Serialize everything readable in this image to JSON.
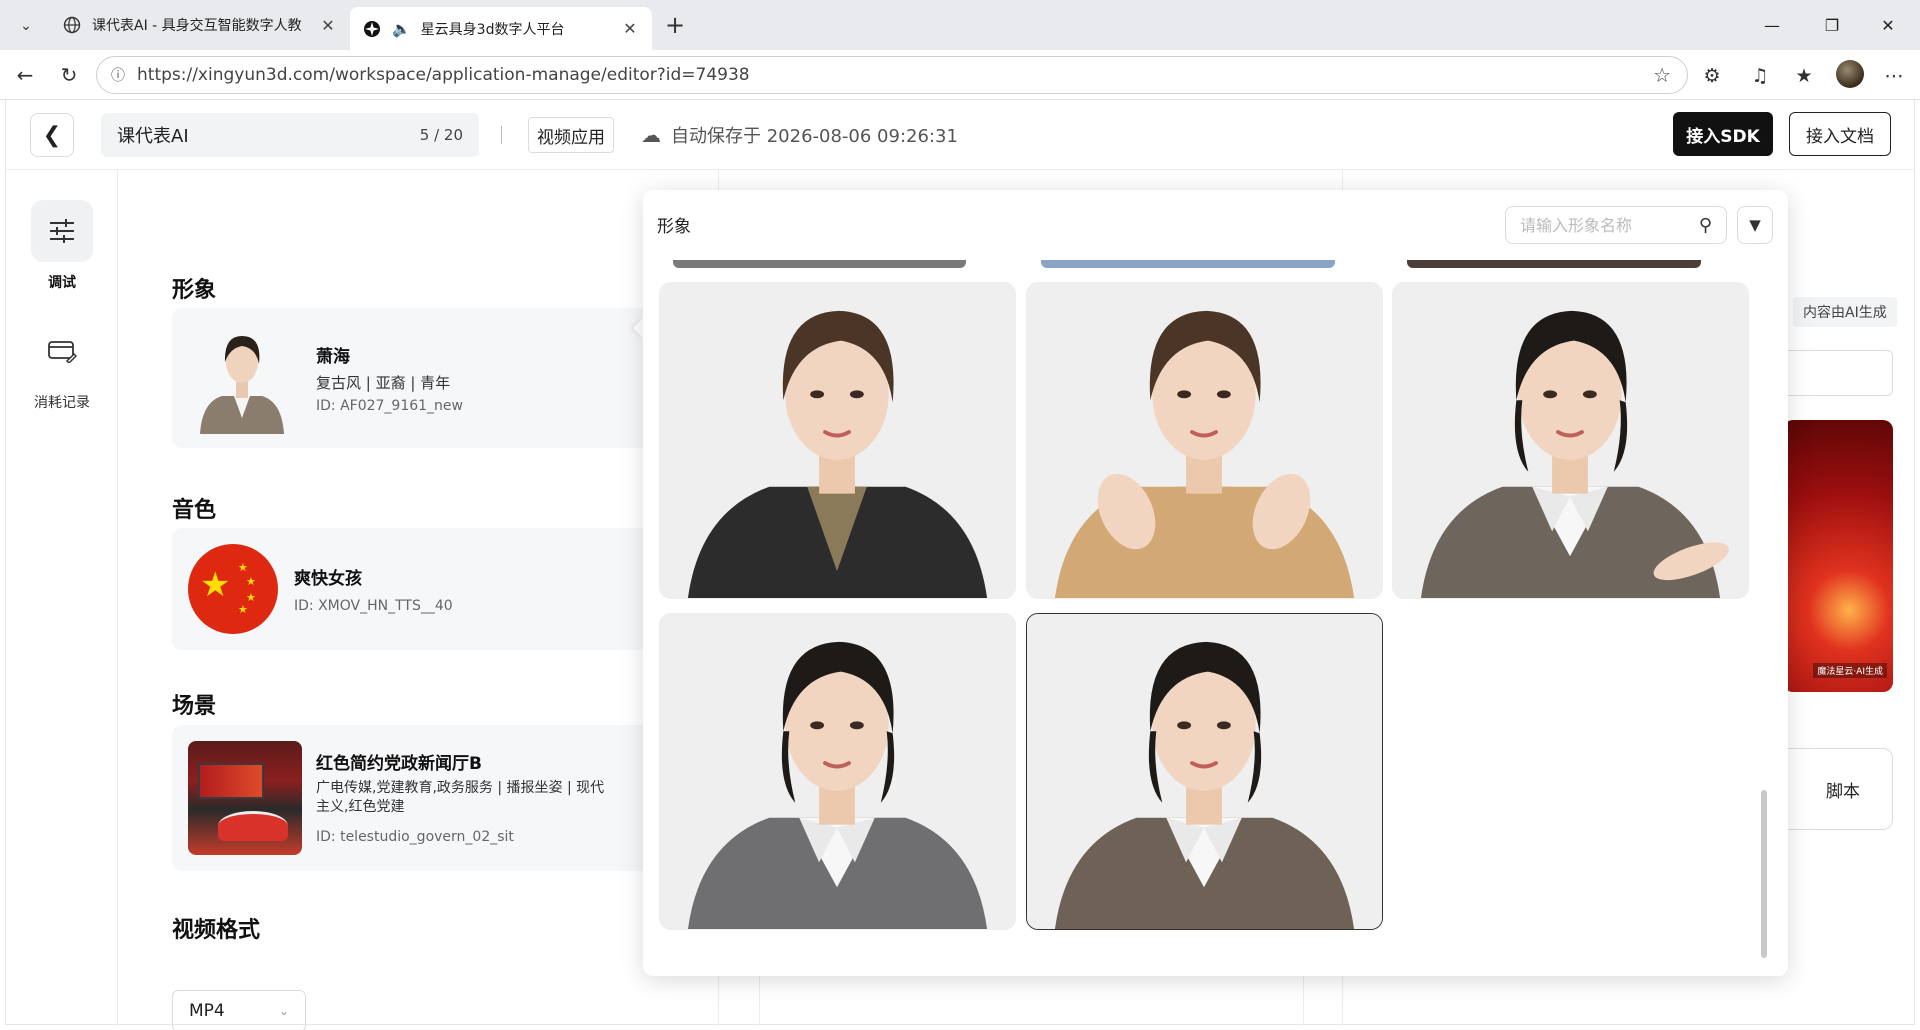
{
  "browser": {
    "tabs": [
      {
        "title": "课代表AI - 具身交互智能数字人教",
        "active": false
      },
      {
        "title": "星云具身3d数字人平台",
        "active": true
      }
    ],
    "url": "https://xingyun3d.com/workspace/application-manage/editor?id=74938"
  },
  "header": {
    "title": "课代表AI",
    "title_count": "5 / 20",
    "app_type": "视频应用",
    "autosave": "自动保存于 2026-08-06 09:26:31",
    "sdk_button": "接入SDK",
    "doc_button": "接入文档"
  },
  "leftnav": [
    {
      "label": "调试",
      "icon": "sliders-icon",
      "active": true
    },
    {
      "label": "消耗记录",
      "icon": "card-edit-icon",
      "active": false
    }
  ],
  "config": {
    "avatar": {
      "section": "形象",
      "name": "萧海",
      "tags": "复古风 | 亚裔 | 青年",
      "id": "ID: AF027_9161_new"
    },
    "voice": {
      "section": "音色",
      "name": "爽快女孩",
      "id": "ID: XMOV_HN_TTS__40"
    },
    "scene": {
      "section": "场景",
      "name": "红色简约党政新闻厅B",
      "tags": "广电传媒,党建教育,政务服务 | 播报坐姿 | 现代主义,红色党建",
      "id": "ID: telestudio_govern_02_sit"
    },
    "format": {
      "section": "视频格式",
      "value": "MP4"
    }
  },
  "right_panel": {
    "ai_badge": "内容由AI生成",
    "script_button": "脚本",
    "preview_tag": "魔法星云·AI生成"
  },
  "popup": {
    "title": "形象",
    "search_placeholder": "请输入形象名称",
    "avatars": [
      {
        "hair": "#4a3526",
        "top": "#2c2c2c",
        "inner": "#8a7a5a",
        "style": "leather-jacket",
        "selected": false
      },
      {
        "hair": "#4a3526",
        "top": "#d2a874",
        "inner": "#d2a874",
        "style": "knit-wave",
        "selected": false
      },
      {
        "hair": "#1e1a17",
        "top": "#6e655c",
        "inner": "#f5f5f5",
        "style": "gray-blazer-wave",
        "selected": false
      },
      {
        "hair": "#1e1a17",
        "top": "#6f6f72",
        "inner": "#f5f5f5",
        "style": "gray-blazer",
        "selected": false
      },
      {
        "hair": "#1e1a17",
        "top": "#6d6255",
        "inner": "#f5f5f5",
        "style": "tweed-blazer",
        "selected": true
      }
    ]
  }
}
